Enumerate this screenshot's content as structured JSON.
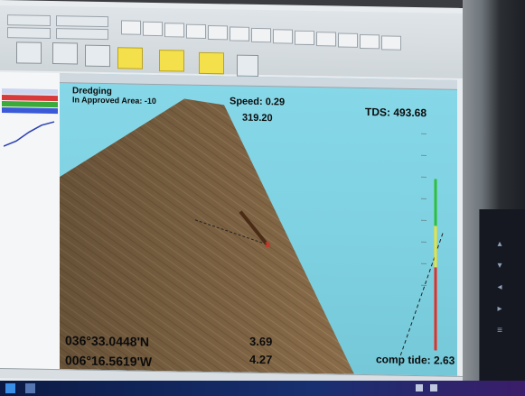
{
  "colors": {
    "water": "#7fd2e2",
    "seabed": "#8a6d4a",
    "gauge_green": "#2fbf3a",
    "gauge_yellow": "#e8e23a",
    "gauge_red": "#e0302a"
  },
  "view": {
    "mode": "Dredging",
    "approved_area": "In Approved Area: -10",
    "speed": "Speed: 0.29",
    "heading": "319.20",
    "tds": "TDS: 493.68",
    "latitude": "036°33.0448'N",
    "longitude": "006°16.5619'W",
    "value_1": "3.69",
    "value_2": "4.27",
    "comp_tide": "comp tide: 2.63"
  },
  "icons": [
    "window-restore-icon",
    "toolbar-icons",
    "bezel-arrow-icons"
  ]
}
